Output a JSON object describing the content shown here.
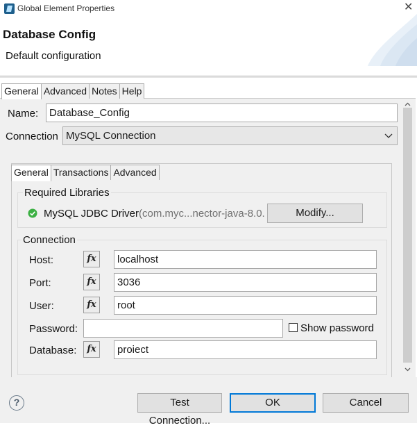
{
  "window": {
    "title": "Global Element Properties",
    "close_glyph": "✕"
  },
  "header": {
    "title": "Database Config",
    "subtitle": "Default configuration"
  },
  "tabs": [
    "General",
    "Advanced",
    "Notes",
    "Help"
  ],
  "name_field": {
    "label": "Name:",
    "value": "Database_Config"
  },
  "connection_field": {
    "label": "Connection",
    "value": "MySQL Connection"
  },
  "inner_tabs": [
    "General",
    "Transactions",
    "Advanced"
  ],
  "required_libraries": {
    "title": "Required Libraries",
    "driver_name": "MySQL JDBC Driver",
    "driver_detail": "(com.myc...nector-java-8.0.",
    "modify_label": "Modify...",
    "status_color": "#3cb043"
  },
  "connection_group": {
    "title": "Connection",
    "host": {
      "label": "Host:",
      "value": "localhost"
    },
    "port": {
      "label": "Port:",
      "value": "3036"
    },
    "user": {
      "label": "User:",
      "value": "root"
    },
    "password": {
      "label": "Password:",
      "value": ""
    },
    "show_password": {
      "label": "Show password",
      "checked": false
    },
    "database": {
      "label": "Database:",
      "value": "proiect"
    },
    "fx_label": "fx"
  },
  "buttons": {
    "help_icon": "?",
    "test_connection": "Test Connection...",
    "ok": "OK",
    "cancel": "Cancel"
  },
  "colors": {
    "accent": "#0078d7",
    "panel_bg": "#f0f0f0"
  }
}
